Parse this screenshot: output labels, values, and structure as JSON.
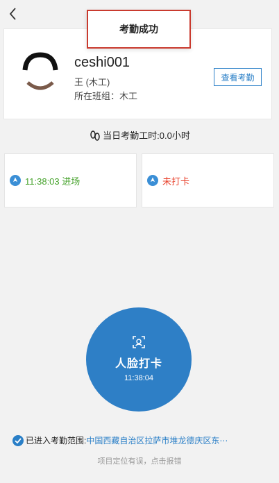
{
  "toast": {
    "text": "考勤成功"
  },
  "user": {
    "name": "ceshi001",
    "role": "王   (木工)",
    "group": "所在班组：木工",
    "view_button": "查看考勤"
  },
  "summary": {
    "hours_text": "当日考勤工时:0.0小时"
  },
  "punch_in": {
    "text": "11:38:03 进场",
    "color": "#45a22b"
  },
  "punch_out": {
    "text": "未打卡",
    "color": "#e8402b"
  },
  "face_button": {
    "label": "人脸打卡",
    "time": "11:38:04",
    "color": "#2e7fc6"
  },
  "range": {
    "prefix": "已进入考勤范围:",
    "address": "中国西藏自治区拉萨市堆龙德庆区东⋯"
  },
  "report_link": "项目定位有误，点击报错",
  "icons": [
    "back-arrow-icon",
    "footprint-icon",
    "location-pin-icon",
    "face-scan-icon",
    "check-circle-icon"
  ]
}
